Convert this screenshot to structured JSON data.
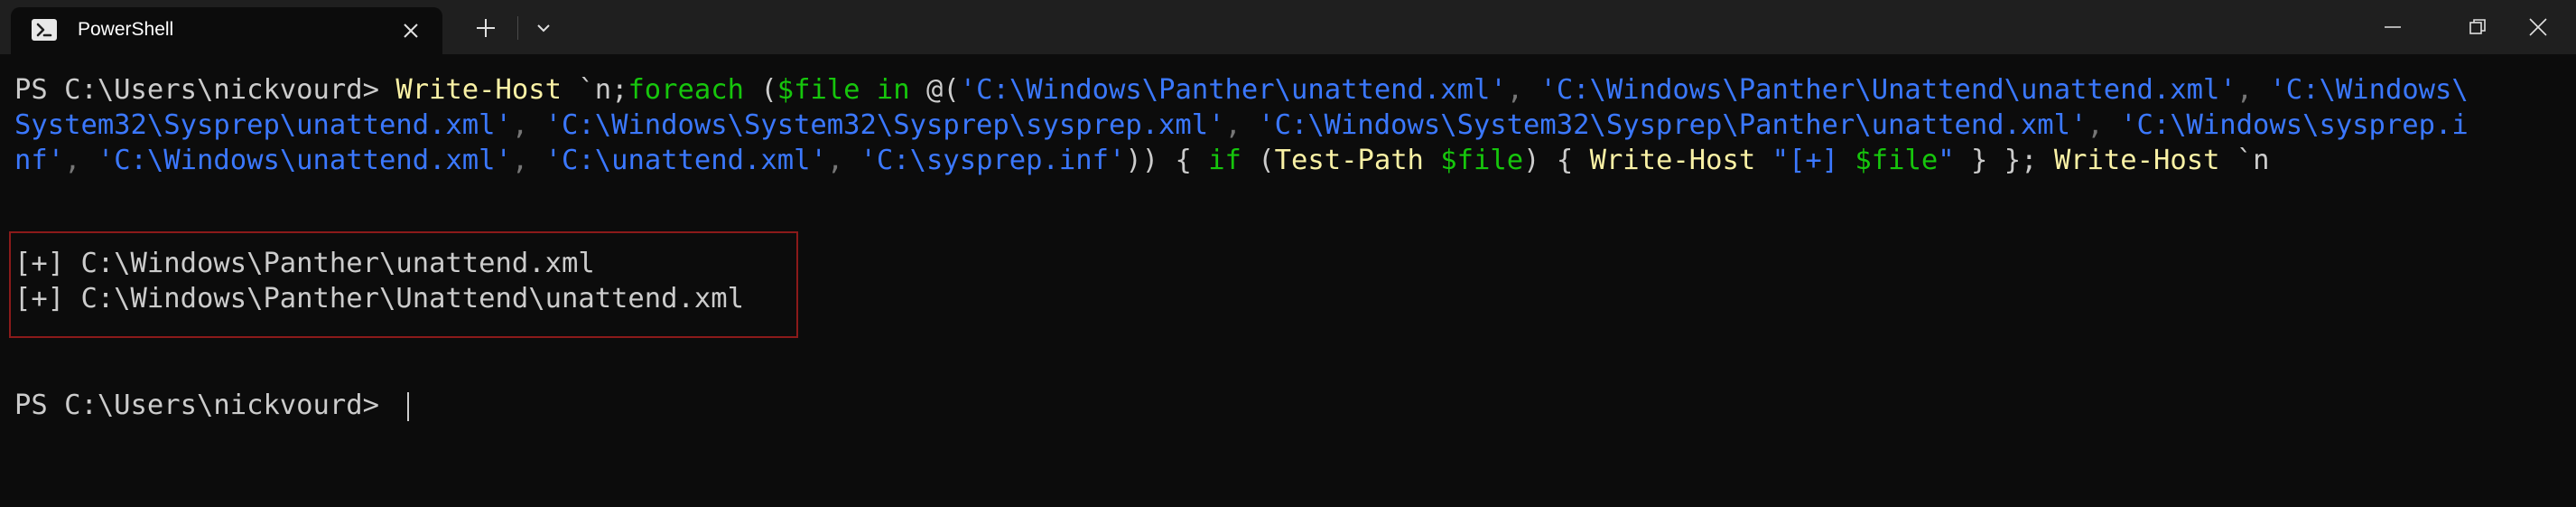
{
  "tab": {
    "title": "PowerShell",
    "icon": "powershell-icon"
  },
  "titlebar": {
    "new_tab_icon": "plus-icon",
    "dropdown_icon": "chevron-down-icon",
    "minimize_icon": "minimize-icon",
    "restore_icon": "restore-icon",
    "close_icon": "close-icon"
  },
  "terminal": {
    "command_lines": [
      [
        {
          "t": "PS C:\\Users\\nickvourd> ",
          "c": "def"
        },
        {
          "t": "Write-Host",
          "c": "cmd"
        },
        {
          "t": " `n;",
          "c": "def"
        },
        {
          "t": "foreach",
          "c": "kw"
        },
        {
          "t": " (",
          "c": "def"
        },
        {
          "t": "$file",
          "c": "var"
        },
        {
          "t": " ",
          "c": "def"
        },
        {
          "t": "in",
          "c": "kw"
        },
        {
          "t": " @(",
          "c": "def"
        },
        {
          "t": "'C:\\Windows\\Panther\\unattend.xml'",
          "c": "str"
        },
        {
          "t": ", ",
          "c": "pun"
        },
        {
          "t": "'C:\\Windows\\Panther\\Unattend\\unattend.xml'",
          "c": "str"
        },
        {
          "t": ", ",
          "c": "pun"
        },
        {
          "t": "'C:\\Windows\\",
          "c": "str"
        }
      ],
      [
        {
          "t": "System32\\Sysprep\\unattend.xml'",
          "c": "str"
        },
        {
          "t": ", ",
          "c": "pun"
        },
        {
          "t": "'C:\\Windows\\System32\\Sysprep\\sysprep.xml'",
          "c": "str"
        },
        {
          "t": ", ",
          "c": "pun"
        },
        {
          "t": "'C:\\Windows\\System32\\Sysprep\\Panther\\unattend.xml'",
          "c": "str"
        },
        {
          "t": ", ",
          "c": "pun"
        },
        {
          "t": "'C:\\Windows\\sysprep.i",
          "c": "str"
        }
      ],
      [
        {
          "t": "nf'",
          "c": "str"
        },
        {
          "t": ", ",
          "c": "pun"
        },
        {
          "t": "'C:\\Windows\\unattend.xml'",
          "c": "str"
        },
        {
          "t": ", ",
          "c": "pun"
        },
        {
          "t": "'C:\\unattend.xml'",
          "c": "str"
        },
        {
          "t": ", ",
          "c": "pun"
        },
        {
          "t": "'C:\\sysprep.inf'",
          "c": "str"
        },
        {
          "t": ")) { ",
          "c": "def"
        },
        {
          "t": "if",
          "c": "kw"
        },
        {
          "t": " (",
          "c": "def"
        },
        {
          "t": "Test-Path",
          "c": "cmd"
        },
        {
          "t": " ",
          "c": "def"
        },
        {
          "t": "$file",
          "c": "var"
        },
        {
          "t": ") { ",
          "c": "def"
        },
        {
          "t": "Write-Host",
          "c": "cmd"
        },
        {
          "t": " ",
          "c": "def"
        },
        {
          "t": "\"[+] ",
          "c": "str"
        },
        {
          "t": "$file",
          "c": "var"
        },
        {
          "t": "\"",
          "c": "str"
        },
        {
          "t": " } }; ",
          "c": "def"
        },
        {
          "t": "Write-Host",
          "c": "cmd"
        },
        {
          "t": " `n",
          "c": "def"
        }
      ]
    ],
    "output_lines": [
      "[+] C:\\Windows\\Panther\\unattend.xml",
      "[+] C:\\Windows\\Panther\\Unattend\\unattend.xml"
    ],
    "prompt": "PS C:\\Users\\nickvourd> "
  },
  "colors": {
    "background": "#0c0c0c",
    "titlebar": "#1f1f1f",
    "text": "#cccccc",
    "command": "#f9f1a5",
    "keyword": "#16c60c",
    "string": "#3b78ff",
    "punctuation": "#767676",
    "highlight_border": "#8b1a1a"
  }
}
